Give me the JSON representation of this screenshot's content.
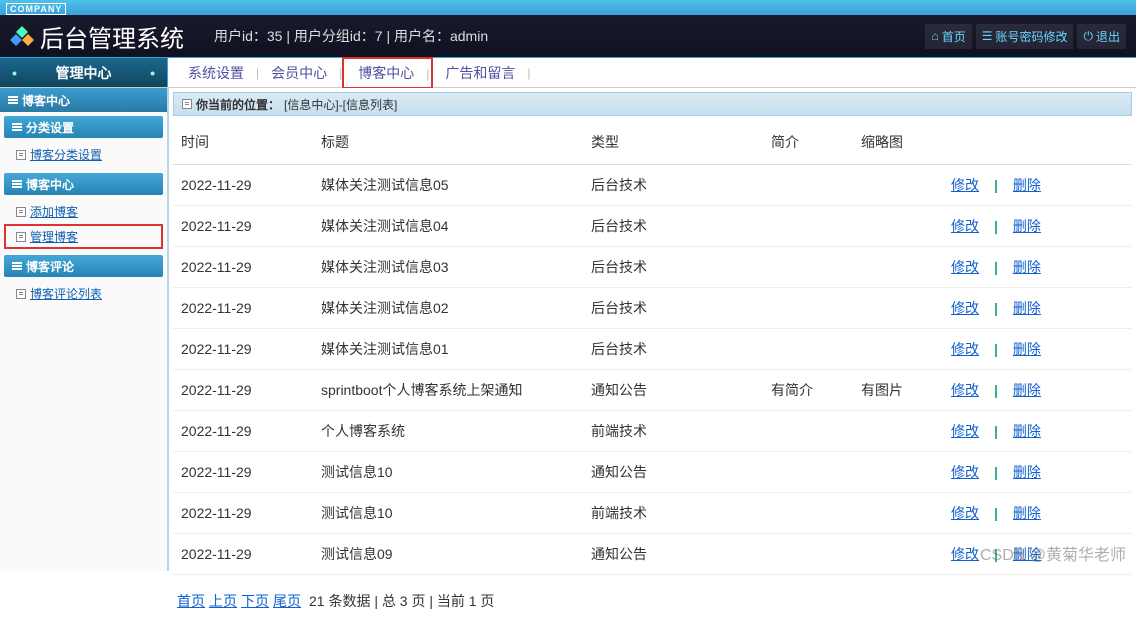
{
  "company_tag": "COMPANY",
  "app_title": "后台管理系统",
  "user_info": "用户id：35 | 用户分组id：7 | 用户名：admin",
  "header_buttons": {
    "home": "首页",
    "pwd": "账号密码修改",
    "logout": "退出"
  },
  "mgmt_center": "管理中心",
  "nav": {
    "sys": "系统设置",
    "member": "会员中心",
    "blog": "博客中心",
    "ads": "广告和留言"
  },
  "nav_sep": "|",
  "sidebar": {
    "top": "博客中心",
    "sections": {
      "a": {
        "title": "分类设置",
        "links": {
          "l1": "博客分类设置"
        }
      },
      "b": {
        "title": "博客中心",
        "links": {
          "l1": "添加博客",
          "l2": "管理博客"
        }
      },
      "c": {
        "title": "博客评论",
        "links": {
          "l1": "博客评论列表"
        }
      }
    }
  },
  "breadcrumb": {
    "label": "你当前的位置：",
    "path": "[信息中心]-[信息列表]"
  },
  "table": {
    "headers": {
      "time": "时间",
      "title": "标题",
      "type": "类型",
      "brief": "简介",
      "thumb": "缩略图"
    },
    "rows": [
      {
        "time": "2022-11-29",
        "title": "媒体关注测试信息05",
        "type": "后台技术",
        "brief": "",
        "thumb": ""
      },
      {
        "time": "2022-11-29",
        "title": "媒体关注测试信息04",
        "type": "后台技术",
        "brief": "",
        "thumb": ""
      },
      {
        "time": "2022-11-29",
        "title": "媒体关注测试信息03",
        "type": "后台技术",
        "brief": "",
        "thumb": ""
      },
      {
        "time": "2022-11-29",
        "title": "媒体关注测试信息02",
        "type": "后台技术",
        "brief": "",
        "thumb": ""
      },
      {
        "time": "2022-11-29",
        "title": "媒体关注测试信息01",
        "type": "后台技术",
        "brief": "",
        "thumb": ""
      },
      {
        "time": "2022-11-29",
        "title": "sprintboot个人博客系统上架通知",
        "type": "通知公告",
        "brief": "有简介",
        "thumb": "有图片"
      },
      {
        "time": "2022-11-29",
        "title": "个人博客系统",
        "type": "前端技术",
        "brief": "",
        "thumb": ""
      },
      {
        "time": "2022-11-29",
        "title": "测试信息10",
        "type": "通知公告",
        "brief": "",
        "thumb": ""
      },
      {
        "time": "2022-11-29",
        "title": "测试信息10",
        "type": "前端技术",
        "brief": "",
        "thumb": ""
      },
      {
        "time": "2022-11-29",
        "title": "测试信息09",
        "type": "通知公告",
        "brief": "",
        "thumb": ""
      }
    ],
    "actions": {
      "edit": "修改",
      "del": "删除"
    }
  },
  "pager": {
    "first": "首页",
    "prev": "上页",
    "next": "下页",
    "last": "尾页",
    "info": "21 条数据 | 总 3 页 | 当前 1 页"
  },
  "watermark": "CSDN @黄菊华老师"
}
